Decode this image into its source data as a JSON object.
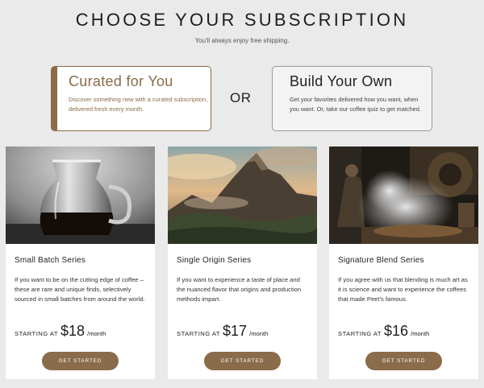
{
  "header": {
    "title": "CHOOSE YOUR SUBSCRIPTION",
    "subtitle": "You'll always enjoy free shipping."
  },
  "options": {
    "curated": {
      "title": "Curated for You",
      "description": "Discover something new with a curated subscription, delivered fresh every month."
    },
    "or_label": "OR",
    "build": {
      "title": "Build Your Own",
      "description": "Get your favorites delivered how you want, when you want. Or, take our coffee quiz to get matched."
    }
  },
  "cards": [
    {
      "title": "Small Batch Series",
      "description": "If you want to be on the cutting edge of coffee – these are rare and unique finds, selectively sourced in small batches from around the world.",
      "starting_label": "STARTING AT",
      "price": "$18",
      "per": "/month",
      "button": "GET STARTED",
      "image": "coffee-carafe-photo"
    },
    {
      "title": "Single Origin Series",
      "description": "If you want to experience a taste of place and the nuanced flavor that origins and production methods impart.",
      "starting_label": "STARTING AT",
      "price": "$17",
      "per": "/month",
      "button": "GET STARTED",
      "image": "mountain-landscape-photo"
    },
    {
      "title": "Signature Blend Series",
      "description": "If you agree with us that blending is much art as it is science and want to experience the coffees that made Peet's famous.",
      "starting_label": "STARTING AT",
      "price": "$16",
      "per": "/month",
      "button": "GET STARTED",
      "image": "coffee-roaster-photo"
    }
  ],
  "colors": {
    "accent": "#8a6b4a",
    "background": "#eaeaea"
  }
}
